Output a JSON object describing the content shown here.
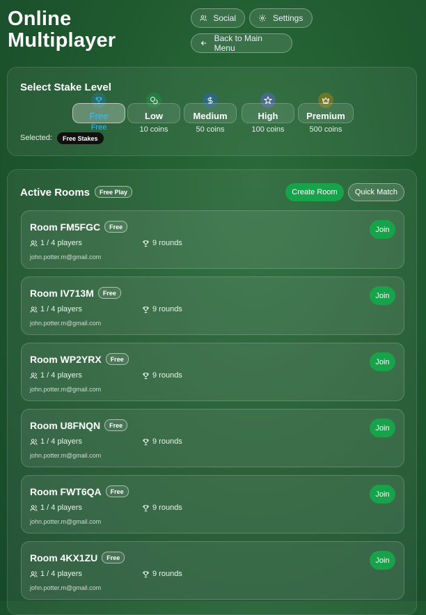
{
  "header": {
    "title_line1": "Online",
    "title_line2": "Multiplayer",
    "social_label": "Social",
    "settings_label": "Settings",
    "back_label": "Back to Main Menu"
  },
  "stake": {
    "heading": "Select Stake Level",
    "selected_label": "Selected:",
    "selected_value": "Free Stakes",
    "levels": [
      {
        "label": "Free",
        "sub": "Free",
        "icon": "trophy-icon",
        "color": "#1e88e5"
      },
      {
        "label": "Low",
        "sub": "10 coins",
        "icon": "coins-icon",
        "color": "#16a34a"
      },
      {
        "label": "Medium",
        "sub": "50 coins",
        "icon": "dollar-icon",
        "color": "#2563eb"
      },
      {
        "label": "High",
        "sub": "100 coins",
        "icon": "star-icon",
        "color": "#6366f1"
      },
      {
        "label": "Premium",
        "sub": "500 coins",
        "icon": "crown-icon",
        "color": "#ca8a04"
      }
    ]
  },
  "rooms_section": {
    "heading": "Active Rooms",
    "badge": "Free Play",
    "create_label": "Create Room",
    "quick_label": "Quick Match",
    "join_label": "Join",
    "rooms": [
      {
        "name": "Room FM5FGC",
        "badge": "Free",
        "players": "1 / 4 players",
        "rounds": "9 rounds",
        "email": "john.potter.m@gmail.com"
      },
      {
        "name": "Room IV713M",
        "badge": "Free",
        "players": "1 / 4 players",
        "rounds": "9 rounds",
        "email": "john.potter.m@gmail.com"
      },
      {
        "name": "Room WP2YRX",
        "badge": "Free",
        "players": "1 / 4 players",
        "rounds": "9 rounds",
        "email": "john.potter.m@gmail.com"
      },
      {
        "name": "Room U8FNQN",
        "badge": "Free",
        "players": "1 / 4 players",
        "rounds": "9 rounds",
        "email": "john.potter.m@gmail.com"
      },
      {
        "name": "Room FWT6QA",
        "badge": "Free",
        "players": "1 / 4 players",
        "rounds": "9 rounds",
        "email": "john.potter.m@gmail.com"
      },
      {
        "name": "Room 4KX1ZU",
        "badge": "Free",
        "players": "1 / 4 players",
        "rounds": "9 rounds",
        "email": "john.potter.m@gmail.com"
      }
    ]
  },
  "colors": {
    "accent_green": "#16a34a",
    "selected_text": "#38bdf8"
  }
}
